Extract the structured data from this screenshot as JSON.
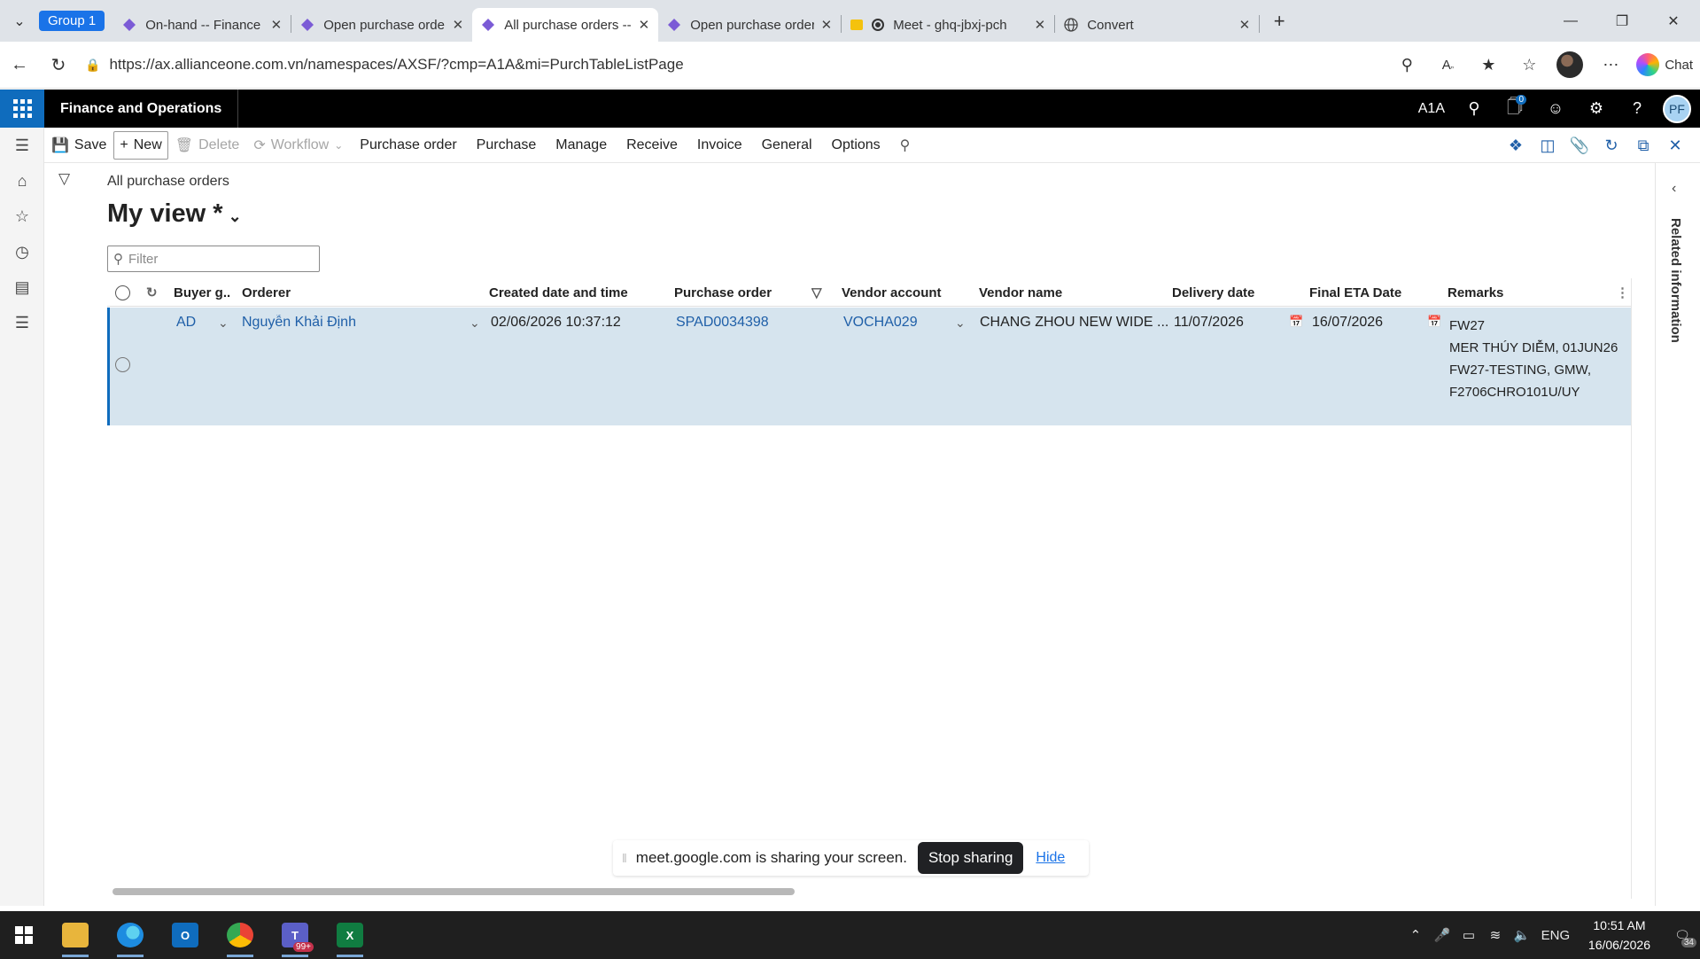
{
  "browser": {
    "group_label": "Group 1",
    "tabs": [
      {
        "title": "On-hand -- Finance and Op",
        "icon": "d365-diamond-icon"
      },
      {
        "title": "Open purchase order lines",
        "icon": "d365-diamond-icon"
      },
      {
        "title": "All purchase orders -- Fina",
        "icon": "d365-diamond-icon"
      },
      {
        "title": "Open purchase order lines",
        "icon": "d365-diamond-icon"
      },
      {
        "title": "Meet - ghq-jbxj-pch",
        "icon": "meet-record-icon"
      },
      {
        "title": "Convert",
        "icon": "globe-icon"
      }
    ],
    "url": "https://ax.allianceone.com.vn/namespaces/AXSF/?cmp=A1A&mi=PurchTableListPage",
    "copilot_label": "Chat"
  },
  "d365": {
    "app_name": "Finance and Operations",
    "company": "A1A",
    "user_initials": "PF",
    "notification_count": "0"
  },
  "actions": {
    "save": "Save",
    "new": "New",
    "delete": "Delete",
    "workflow": "Workflow",
    "tabs": [
      "Purchase order",
      "Purchase",
      "Manage",
      "Receive",
      "Invoice",
      "General",
      "Options"
    ]
  },
  "page": {
    "breadcrumb": "All purchase orders",
    "view_name": "My view *",
    "filter_placeholder": "Filter"
  },
  "grid": {
    "columns": [
      "Buyer g...",
      "Orderer",
      "Created date and time",
      "Purchase order",
      "Vendor account",
      "Vendor name",
      "Delivery date",
      "Final ETA Date",
      "Remarks"
    ],
    "rows": [
      {
        "buyer_group": "AD",
        "orderer": "Nguyễn Khải Định",
        "created": "02/06/2026 10:37:12",
        "purchase_order": "SPAD0034398",
        "vendor_account": "VOCHA029",
        "vendor_name": "CHANG ZHOU NEW WIDE ...",
        "delivery_date": "11/07/2026",
        "final_eta": "16/07/2026",
        "remarks": [
          "FW27",
          "MER THÚY DIỄM, 01JUN26",
          "FW27-TESTING, GMW,",
          "F2706CHRO101U/UY"
        ]
      }
    ]
  },
  "related_info": "Related information",
  "screen_share": {
    "message": "meet.google.com is sharing your screen.",
    "stop_label": "Stop sharing",
    "hide_label": "Hide"
  },
  "taskbar": {
    "teams_badge": "99+",
    "language": "ENG",
    "time": "10:51 AM",
    "date": "16/06/2026",
    "notification_count": "34"
  },
  "colors": {
    "d365_accent": "#0f6cbd",
    "selected_row": "#d6e4ee",
    "link": "#1f5fa8",
    "browser_group": "#1a73e8"
  }
}
